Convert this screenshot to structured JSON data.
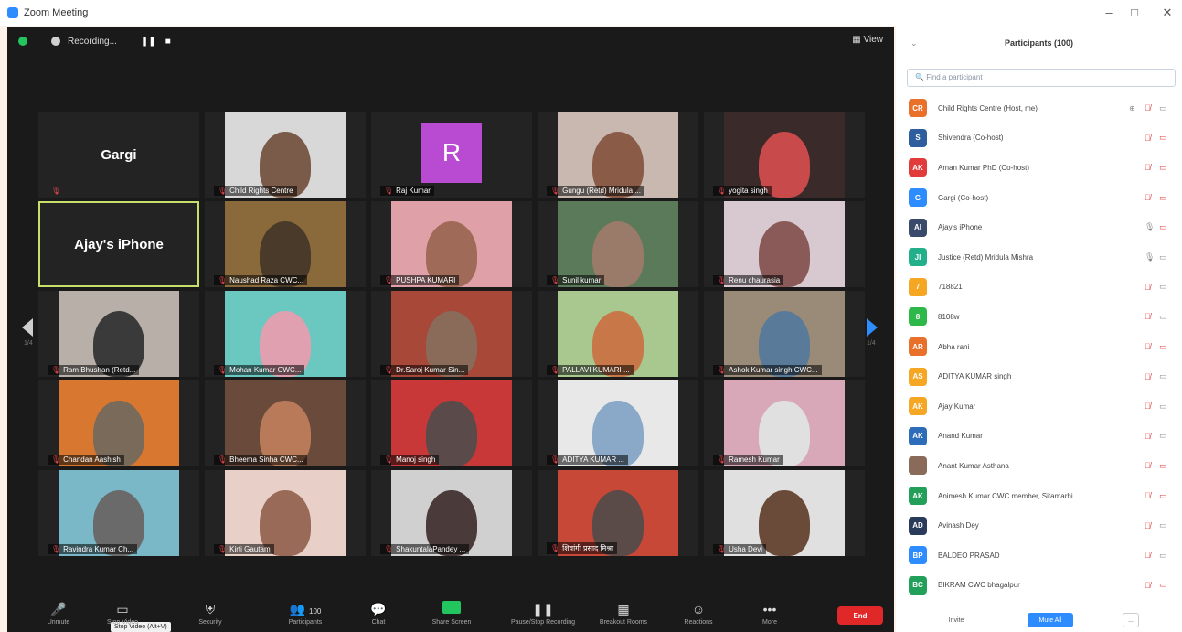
{
  "window": {
    "title": "Zoom Meeting",
    "controls": [
      "–",
      "□",
      "✕"
    ]
  },
  "topbar": {
    "recording_label": "Recording...",
    "pause": "❚❚",
    "stop": "■",
    "view_label": "View"
  },
  "tiles": [
    {
      "id": "gargi",
      "label": "Gargi",
      "type": "name",
      "mic_muted": true
    },
    {
      "id": "child-rights",
      "label": "Child Rights Centre",
      "type": "video",
      "bg": "#d8d8d8",
      "person": "#7a5a48"
    },
    {
      "id": "raj",
      "label": "Raj Kumar",
      "type": "avatar",
      "initial": "R"
    },
    {
      "id": "gungu",
      "label": "Gungu (Retd) Mridula ...",
      "type": "video",
      "bg": "#c8b8b0",
      "person": "#8a5c48"
    },
    {
      "id": "yogita",
      "label": "yogita singh",
      "type": "video",
      "bg": "#3a2a2a",
      "person": "#c84a4a"
    },
    {
      "id": "ajay",
      "label": "Ajay's iPhone",
      "type": "name",
      "active": true
    },
    {
      "id": "naushad",
      "label": "Naushad Raza CWC...",
      "type": "video",
      "bg": "#8a6a3a",
      "person": "#4a3a2a"
    },
    {
      "id": "pushpa",
      "label": "PUSHPA KUMARI",
      "type": "video",
      "bg": "#e0a0a8",
      "person": "#a06a58"
    },
    {
      "id": "sunil",
      "label": "Sunil kumar",
      "type": "video",
      "bg": "#5a7a5a",
      "person": "#9a7a68"
    },
    {
      "id": "renu",
      "label": "Renu chaurasia",
      "type": "video",
      "bg": "#d8c8d0",
      "person": "#8a5a58"
    },
    {
      "id": "ram",
      "label": "Ram Bhushan (Retd...",
      "type": "video",
      "bg": "#b8b0a8",
      "person": "#3a3a3a"
    },
    {
      "id": "mohan",
      "label": "Mohan Kumar CWC...",
      "type": "video",
      "bg": "#6ac8c0",
      "person": "#e0a0b0"
    },
    {
      "id": "saroj",
      "label": "Dr.Saroj Kumar Sin...",
      "type": "video",
      "bg": "#a84838",
      "person": "#8a6a58"
    },
    {
      "id": "pallavi",
      "label": "PALLAVI KUMARI ...",
      "type": "video",
      "bg": "#a8c890",
      "person": "#c87848"
    },
    {
      "id": "ashok",
      "label": "Ashok Kumar singh CWC...",
      "type": "video",
      "bg": "#9a8a78",
      "person": "#5a7a9a"
    },
    {
      "id": "chandan",
      "label": "Chandan Aashish",
      "type": "video",
      "bg": "#d87830",
      "person": "#7a6a5a"
    },
    {
      "id": "bheema",
      "label": "Bheema Sinha CWC...",
      "type": "video",
      "bg": "#6a4a3a",
      "person": "#b87a58"
    },
    {
      "id": "manoj",
      "label": "Manoj singh",
      "type": "video",
      "bg": "#c83838",
      "person": "#5a4a4a"
    },
    {
      "id": "aditya",
      "label": "ADITYA KUMAR ...",
      "type": "video",
      "bg": "#e8e8e8",
      "person": "#8aa8c8"
    },
    {
      "id": "ramesh",
      "label": "Ramesh Kumar",
      "type": "video",
      "bg": "#d8a8b8",
      "person": "#e0e0e0"
    },
    {
      "id": "ravindra",
      "label": "Ravindra Kumar Ch...",
      "type": "video",
      "bg": "#7ab8c8",
      "person": "#6a6a6a"
    },
    {
      "id": "kirti",
      "label": "Kirti Gautam",
      "type": "video",
      "bg": "#e8d0c8",
      "person": "#9a6a58"
    },
    {
      "id": "shakuntala",
      "label": "ShakuntalaPandey ...",
      "type": "video",
      "bg": "#d0d0d0",
      "person": "#4a3a3a"
    },
    {
      "id": "hindi",
      "label": "शिवांगी प्रसाद मिश्रा",
      "type": "video",
      "bg": "#c84838",
      "person": "#5a4a48"
    },
    {
      "id": "usha",
      "label": "Usha Devi",
      "type": "video",
      "bg": "#e0e0e0",
      "person": "#6a4a38"
    }
  ],
  "pager": {
    "left": "1/4",
    "right": "1/4"
  },
  "toolbar": {
    "items": [
      {
        "id": "unmute",
        "label": "Unmute",
        "icon": "🎤"
      },
      {
        "id": "stop-video",
        "label": "Stop Video",
        "icon": "▭"
      },
      {
        "id": "security",
        "label": "Security",
        "icon": "⛨"
      },
      {
        "id": "participants",
        "label": "Participants",
        "icon": "👥",
        "count": "100"
      },
      {
        "id": "chat",
        "label": "Chat",
        "icon": "💬"
      },
      {
        "id": "share-screen",
        "label": "Share Screen",
        "icon": ""
      },
      {
        "id": "recording",
        "label": "Pause/Stop Recording",
        "icon": "❚❚"
      },
      {
        "id": "breakout",
        "label": "Breakout Rooms",
        "icon": "▦"
      },
      {
        "id": "reactions",
        "label": "Reactions",
        "icon": "☺"
      },
      {
        "id": "more",
        "label": "More",
        "icon": "•••"
      }
    ],
    "tooltip": "Stop Video (Alt+V)",
    "end_label": "End"
  },
  "panel": {
    "title": "Participants (100)",
    "search_placeholder": "Find a participant",
    "participants": [
      {
        "initials": "CR",
        "name": "Child Rights Centre (Host, me)",
        "color": "#e8702a",
        "mic": "muted",
        "cam": "on",
        "extra": "⊕"
      },
      {
        "initials": "S",
        "name": "Shivendra (Co-host)",
        "color": "#2e5e9e",
        "mic": "muted",
        "cam": "off"
      },
      {
        "initials": "AK",
        "name": "Aman Kumar PhD (Co-host)",
        "color": "#e23b3b",
        "mic": "muted",
        "cam": "off"
      },
      {
        "initials": "G",
        "name": "Gargi (Co-host)",
        "color": "#2d8cff",
        "mic": "muted",
        "cam": "off"
      },
      {
        "initials": "AI",
        "name": "Ajay's iPhone",
        "color": "#3a4a6a",
        "mic": "on",
        "cam": "off"
      },
      {
        "initials": "JI",
        "name": "Justice (Retd) Mridula Mishra",
        "color": "#22b08a",
        "mic": "on",
        "cam": "on"
      },
      {
        "initials": "7",
        "name": "718821",
        "color": "#f5a623",
        "mic": "muted",
        "cam": "on"
      },
      {
        "initials": "8",
        "name": "8108w",
        "color": "#2fb84a",
        "mic": "muted",
        "cam": "on"
      },
      {
        "initials": "AR",
        "name": "Abha rani",
        "color": "#e8702a",
        "mic": "muted",
        "cam": "off"
      },
      {
        "initials": "AS",
        "name": "ADITYA KUMAR singh",
        "color": "#f5a623",
        "mic": "muted",
        "cam": "on"
      },
      {
        "initials": "AK",
        "name": "Ajay Kumar",
        "color": "#f5a623",
        "mic": "muted",
        "cam": "on"
      },
      {
        "initials": "AK",
        "name": "Anand Kumar",
        "color": "#2d6cb8",
        "mic": "muted",
        "cam": "on"
      },
      {
        "initials": "",
        "name": "Anant Kumar Asthana",
        "color": "#8a6a58",
        "mic": "muted",
        "cam": "off"
      },
      {
        "initials": "AK",
        "name": "Animesh Kumar CWC member, Sitamarhi",
        "color": "#22a05a",
        "mic": "muted",
        "cam": "off"
      },
      {
        "initials": "AD",
        "name": "Avinash Dey",
        "color": "#2a3a5a",
        "mic": "muted",
        "cam": "on"
      },
      {
        "initials": "BP",
        "name": "BALDEO PRASAD",
        "color": "#2d8cff",
        "mic": "muted",
        "cam": "on"
      },
      {
        "initials": "BC",
        "name": "BIKRAM CWC bhagalpur",
        "color": "#22a05a",
        "mic": "muted",
        "cam": "off"
      }
    ],
    "footer": {
      "invite": "Invite",
      "mute_all": "Mute All",
      "more": "..."
    }
  }
}
